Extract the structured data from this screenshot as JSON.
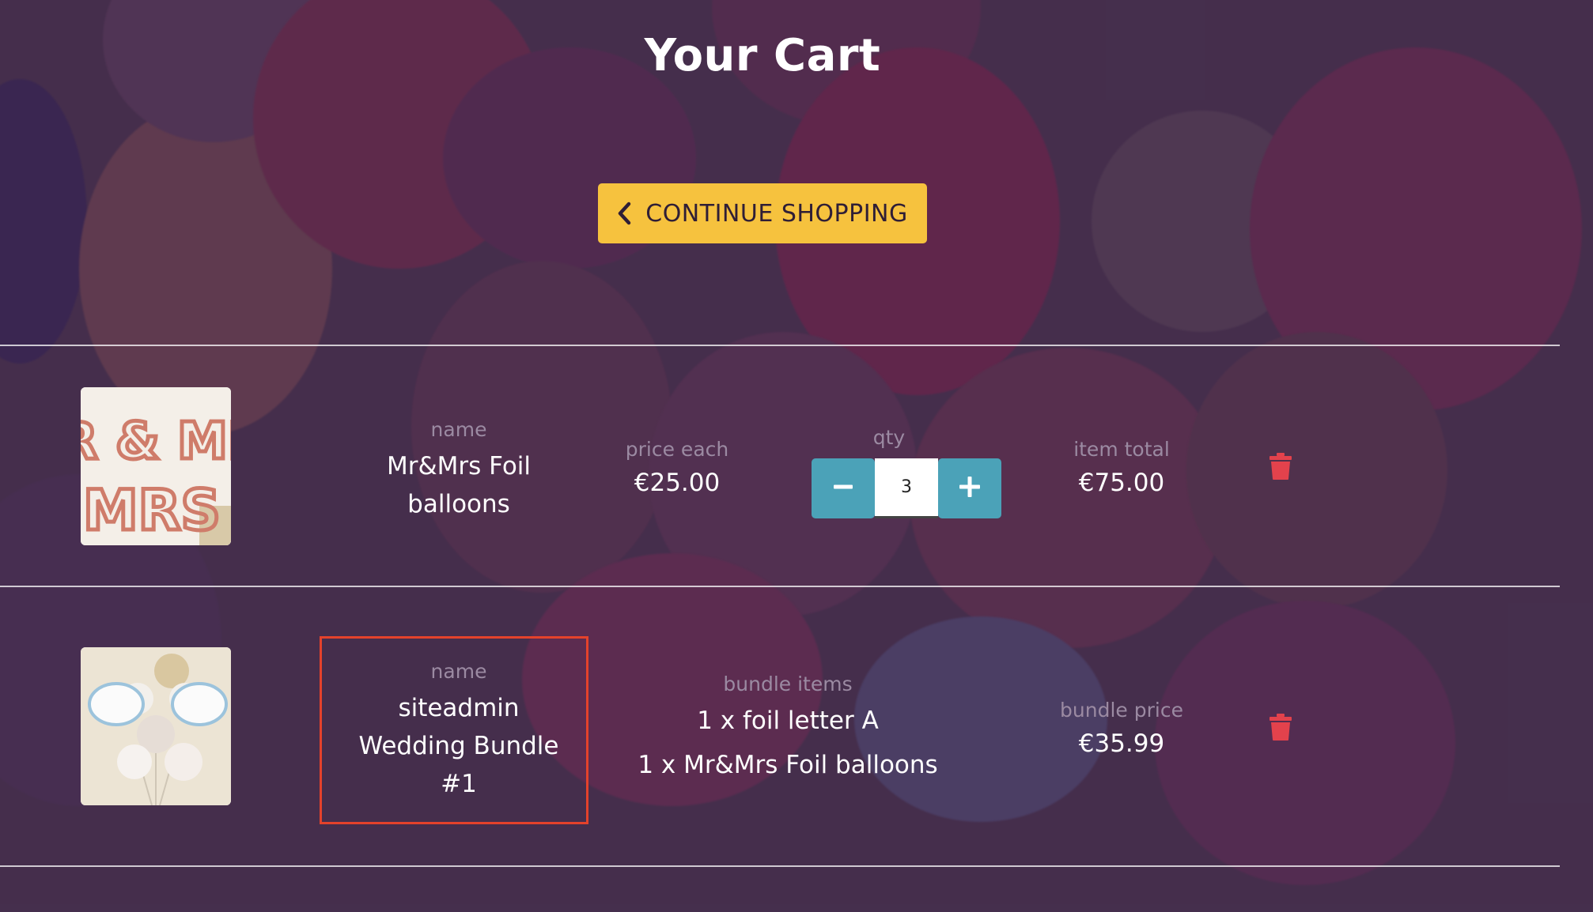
{
  "page": {
    "title": "Your Cart"
  },
  "nav": {
    "continue_label": "CONTINUE SHOPPING"
  },
  "items": [
    {
      "image_alt": "MR & MRS",
      "name_label": "name",
      "name": [
        "Mr&Mrs Foil",
        "balloons"
      ],
      "price_label": "price each",
      "price": "€25.00",
      "qty_label": "qty",
      "qty": "3",
      "total_label": "item total",
      "total": "€75.00"
    }
  ],
  "bundles": [
    {
      "name_label": "name",
      "name": [
        "siteadmin",
        "Wedding Bundle",
        "#1"
      ],
      "items_label": "bundle items",
      "items": [
        "1 x foil letter A",
        "1 x Mr&Mrs Foil balloons"
      ],
      "price_label": "bundle price",
      "price": "€35.99"
    }
  ],
  "colors": {
    "accent": "#f6c23e",
    "qty_button": "#4ba2b8",
    "delete": "#e3424c",
    "highlight": "#e4422b"
  },
  "icons": {
    "continue": "chevron-left-icon",
    "decrement": "minus-icon",
    "increment": "plus-icon",
    "delete": "trash-icon"
  }
}
